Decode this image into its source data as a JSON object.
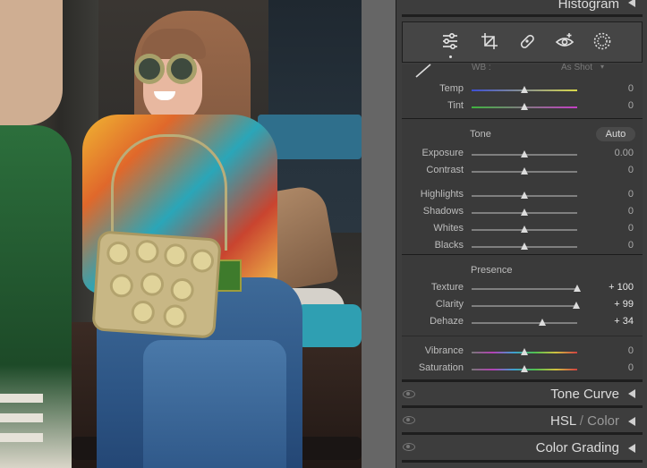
{
  "panel_headers": {
    "histogram": "Histogram",
    "tone_curve": "Tone Curve",
    "hsl_left": "HSL",
    "hsl_slash": " / ",
    "hsl_right": "Color",
    "color_grading": "Color Grading"
  },
  "toolbar": {
    "tools": [
      "edit-sliders-icon",
      "crop-icon",
      "healing-icon",
      "red-eye-icon",
      "masking-icon"
    ],
    "active_tool": "edit-sliders-icon"
  },
  "white_balance": {
    "label": "WB :",
    "value": "As Shot",
    "temp": {
      "label": "Temp",
      "value": "0",
      "position": 0.5
    },
    "tint": {
      "label": "Tint",
      "value": "0",
      "position": 0.5
    }
  },
  "tone": {
    "title": "Tone",
    "auto_label": "Auto",
    "exposure": {
      "label": "Exposure",
      "value": "0.00",
      "position": 0.5
    },
    "contrast": {
      "label": "Contrast",
      "value": "0",
      "position": 0.5
    },
    "highlights": {
      "label": "Highlights",
      "value": "0",
      "position": 0.5
    },
    "shadows": {
      "label": "Shadows",
      "value": "0",
      "position": 0.5
    },
    "whites": {
      "label": "Whites",
      "value": "0",
      "position": 0.5
    },
    "blacks": {
      "label": "Blacks",
      "value": "0",
      "position": 0.5
    }
  },
  "presence": {
    "title": "Presence",
    "texture": {
      "label": "Texture",
      "value": "+ 100",
      "position": 1.0
    },
    "clarity": {
      "label": "Clarity",
      "value": "+ 99",
      "position": 0.995
    },
    "dehaze": {
      "label": "Dehaze",
      "value": "+ 34",
      "position": 0.67
    },
    "vibrance": {
      "label": "Vibrance",
      "value": "0",
      "position": 0.5
    },
    "saturation": {
      "label": "Saturation",
      "value": "0",
      "position": 0.5
    }
  },
  "colors": {
    "panel_bg": "#3d3d3d",
    "gutter": "#666666",
    "text": "#c8c8c8"
  }
}
